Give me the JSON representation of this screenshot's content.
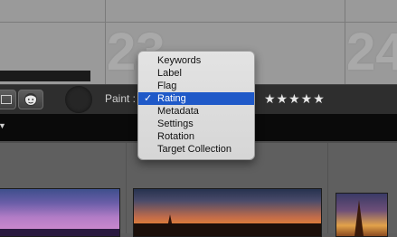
{
  "grid": {
    "cell_numbers": [
      "23",
      "24"
    ]
  },
  "toolbar": {
    "paint_label": "Paint :",
    "rating_stars": "★★★★★",
    "grid_icon": "grid-view-icon",
    "face_icon": "people-view-icon"
  },
  "filter_bar": {
    "arrow_icon": "triangle-down-icon",
    "arrow_glyph": "▼"
  },
  "paint_menu": {
    "checkmark": "✓",
    "selected_index": 3,
    "items": [
      {
        "label": "Keywords"
      },
      {
        "label": "Label"
      },
      {
        "label": "Flag"
      },
      {
        "label": "Rating"
      },
      {
        "label": "Metadata"
      },
      {
        "label": "Settings"
      },
      {
        "label": "Rotation"
      },
      {
        "label": "Target Collection"
      }
    ]
  },
  "colors": {
    "menu_highlight": "#1f59c8",
    "toolbar_bg": "#2e2e2e",
    "grid_bg": "#9a9a9a"
  }
}
